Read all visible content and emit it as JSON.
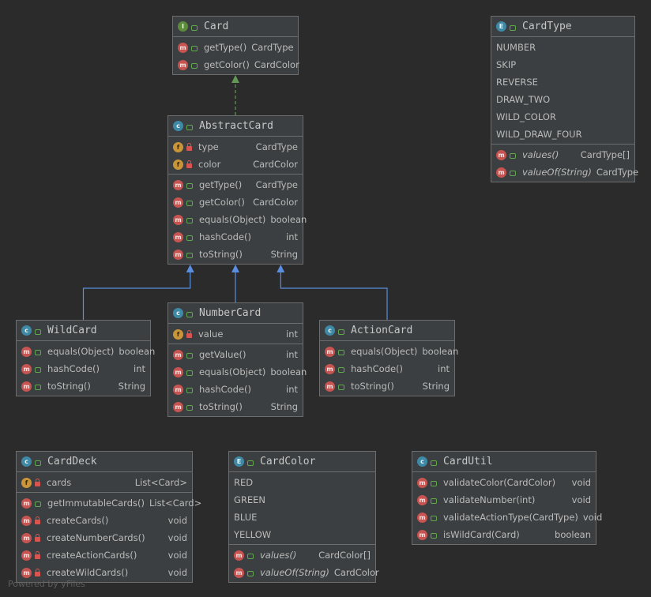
{
  "classes": [
    {
      "key": "card",
      "name": "Card",
      "kind": "I",
      "box": "card",
      "sections": [
        [
          {
            "icon": "m",
            "vis": "pub",
            "name": "getType()",
            "type": "CardType"
          },
          {
            "icon": "m",
            "vis": "pub",
            "name": "getColor()",
            "type": "CardColor"
          }
        ]
      ]
    },
    {
      "key": "cardtype",
      "name": "CardType",
      "kind": "E",
      "box": "cardtype",
      "sections": [
        [
          {
            "name": "NUMBER"
          },
          {
            "name": "SKIP"
          },
          {
            "name": "REVERSE"
          },
          {
            "name": "DRAW_TWO"
          },
          {
            "name": "WILD_COLOR"
          },
          {
            "name": "WILD_DRAW_FOUR"
          }
        ],
        [
          {
            "icon": "m",
            "vis": "pub",
            "name": "values()",
            "type": "CardType[]",
            "italic": true
          },
          {
            "icon": "m",
            "vis": "pub",
            "name": "valueOf(String)",
            "type": "CardType",
            "italic": true
          }
        ]
      ]
    },
    {
      "key": "abstractcard",
      "name": "AbstractCard",
      "kind": "C",
      "box": "abstractcard",
      "sections": [
        [
          {
            "icon": "f",
            "vis": "pri",
            "name": "type",
            "type": "CardType"
          },
          {
            "icon": "f",
            "vis": "pri",
            "name": "color",
            "type": "CardColor"
          }
        ],
        [
          {
            "icon": "m",
            "vis": "pub",
            "name": "getType()",
            "type": "CardType"
          },
          {
            "icon": "m",
            "vis": "pub",
            "name": "getColor()",
            "type": "CardColor"
          },
          {
            "icon": "m",
            "vis": "pub",
            "name": "equals(Object)",
            "type": "boolean"
          },
          {
            "icon": "m",
            "vis": "pub",
            "name": "hashCode()",
            "type": "int"
          },
          {
            "icon": "m",
            "vis": "pub",
            "name": "toString()",
            "type": "String"
          }
        ]
      ]
    },
    {
      "key": "wildcard",
      "name": "WildCard",
      "kind": "C",
      "box": "wildcard",
      "sections": [
        [
          {
            "icon": "m",
            "vis": "pub",
            "name": "equals(Object)",
            "type": "boolean"
          },
          {
            "icon": "m",
            "vis": "pub",
            "name": "hashCode()",
            "type": "int"
          },
          {
            "icon": "m",
            "vis": "pub",
            "name": "toString()",
            "type": "String"
          }
        ]
      ]
    },
    {
      "key": "numbercard",
      "name": "NumberCard",
      "kind": "C",
      "box": "numbercard",
      "sections": [
        [
          {
            "icon": "f",
            "vis": "pri",
            "name": "value",
            "type": "int"
          }
        ],
        [
          {
            "icon": "m",
            "vis": "pub",
            "name": "getValue()",
            "type": "int"
          },
          {
            "icon": "m",
            "vis": "pub",
            "name": "equals(Object)",
            "type": "boolean"
          },
          {
            "icon": "m",
            "vis": "pub",
            "name": "hashCode()",
            "type": "int"
          },
          {
            "icon": "m",
            "vis": "pub",
            "name": "toString()",
            "type": "String"
          }
        ]
      ]
    },
    {
      "key": "actioncard",
      "name": "ActionCard",
      "kind": "C",
      "box": "actioncard",
      "sections": [
        [
          {
            "icon": "m",
            "vis": "pub",
            "name": "equals(Object)",
            "type": "boolean"
          },
          {
            "icon": "m",
            "vis": "pub",
            "name": "hashCode()",
            "type": "int"
          },
          {
            "icon": "m",
            "vis": "pub",
            "name": "toString()",
            "type": "String"
          }
        ]
      ]
    },
    {
      "key": "carddeck",
      "name": "CardDeck",
      "kind": "C",
      "box": "carddeck",
      "sections": [
        [
          {
            "icon": "f",
            "vis": "pri",
            "name": "cards",
            "type": "List<Card>"
          }
        ],
        [
          {
            "icon": "m",
            "vis": "pub",
            "name": "getImmutableCards()",
            "type": "List<Card>"
          },
          {
            "icon": "m",
            "vis": "pri",
            "name": "createCards()",
            "type": "void"
          },
          {
            "icon": "m",
            "vis": "pri",
            "name": "createNumberCards()",
            "type": "void"
          },
          {
            "icon": "m",
            "vis": "pri",
            "name": "createActionCards()",
            "type": "void"
          },
          {
            "icon": "m",
            "vis": "pri",
            "name": "createWildCards()",
            "type": "void"
          }
        ]
      ]
    },
    {
      "key": "cardcolor",
      "name": "CardColor",
      "kind": "E",
      "box": "cardcolor",
      "sections": [
        [
          {
            "name": "RED"
          },
          {
            "name": "GREEN"
          },
          {
            "name": "BLUE"
          },
          {
            "name": "YELLOW"
          }
        ],
        [
          {
            "icon": "m",
            "vis": "pub",
            "name": "values()",
            "type": "CardColor[]",
            "italic": true
          },
          {
            "icon": "m",
            "vis": "pub",
            "name": "valueOf(String)",
            "type": "CardColor",
            "italic": true
          }
        ]
      ]
    },
    {
      "key": "cardutil",
      "name": "CardUtil",
      "kind": "C",
      "box": "cardutil",
      "sections": [
        [
          {
            "icon": "m",
            "vis": "pub",
            "name": "validateColor(CardColor)",
            "type": "void"
          },
          {
            "icon": "m",
            "vis": "pub",
            "name": "validateNumber(int)",
            "type": "void"
          },
          {
            "icon": "m",
            "vis": "pub",
            "name": "validateActionType(CardType)",
            "type": "void"
          },
          {
            "icon": "m",
            "vis": "pub",
            "name": "isWildCard(Card)",
            "type": "boolean"
          }
        ]
      ]
    }
  ],
  "relations": [
    {
      "from": "abstractcard",
      "to": "card",
      "kind": "implements"
    },
    {
      "from": "wildcard",
      "to": "abstractcard",
      "kind": "extends"
    },
    {
      "from": "numbercard",
      "to": "abstractcard",
      "kind": "extends"
    },
    {
      "from": "actioncard",
      "to": "abstractcard",
      "kind": "extends"
    }
  ],
  "colors": {
    "implements": "#629755",
    "extends": "#5a8ee0"
  },
  "watermark": "Powered by yFiles"
}
